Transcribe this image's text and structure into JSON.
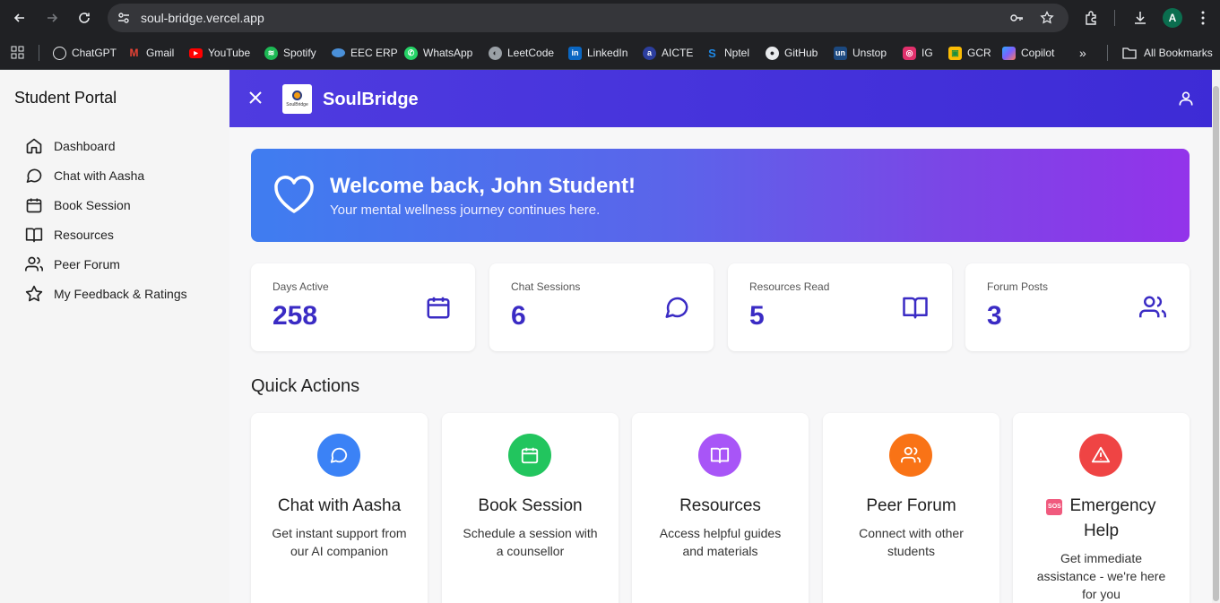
{
  "browser": {
    "url": "soul-bridge.vercel.app",
    "profile_initial": "A",
    "bookmarks": [
      {
        "label": "ChatGPT",
        "icon": "chatgpt-icon",
        "color": "#e8eaed"
      },
      {
        "label": "Gmail",
        "icon": "gmail-icon",
        "color": "#ea4335"
      },
      {
        "label": "YouTube",
        "icon": "youtube-icon",
        "color": "#ff0000"
      },
      {
        "label": "Spotify",
        "icon": "spotify-icon",
        "color": "#1db954"
      },
      {
        "label": "EEC ERP",
        "icon": "eec-erp-icon",
        "color": "#4a90d9"
      },
      {
        "label": "WhatsApp",
        "icon": "whatsapp-icon",
        "color": "#25d366"
      },
      {
        "label": "LeetCode",
        "icon": "leetcode-icon",
        "color": "#9aa0a6"
      },
      {
        "label": "LinkedIn",
        "icon": "linkedin-icon",
        "color": "#0a66c2"
      },
      {
        "label": "AICTE",
        "icon": "aicte-icon",
        "color": "#2c3e9e"
      },
      {
        "label": "Nptel",
        "icon": "nptel-icon",
        "color": "#1e88e5"
      },
      {
        "label": "GitHub",
        "icon": "github-icon",
        "color": "#e8eaed"
      },
      {
        "label": "Unstop",
        "icon": "unstop-icon",
        "color": "#1c4980"
      },
      {
        "label": "IG",
        "icon": "instagram-icon",
        "color": "#e1306c"
      },
      {
        "label": "GCR",
        "icon": "google-classroom-icon",
        "color": "#fbbc04"
      },
      {
        "label": "Copilot",
        "icon": "copilot-icon",
        "color": "#7b61ff"
      }
    ],
    "all_bookmarks": "All Bookmarks"
  },
  "sidebar": {
    "title": "Student Portal",
    "items": [
      {
        "label": "Dashboard",
        "icon": "home-icon"
      },
      {
        "label": "Chat with Aasha",
        "icon": "chat-icon"
      },
      {
        "label": "Book Session",
        "icon": "calendar-icon"
      },
      {
        "label": "Resources",
        "icon": "book-icon"
      },
      {
        "label": "Peer Forum",
        "icon": "users-icon"
      },
      {
        "label": "My Feedback & Ratings",
        "icon": "star-icon"
      }
    ]
  },
  "header": {
    "brand": "SoulBridge",
    "logo_text": "SoulBridge",
    "accent": "#4433dd"
  },
  "banner": {
    "title": "Welcome back, John Student!",
    "subtitle": "Your mental wellness journey continues here."
  },
  "stats": [
    {
      "label": "Days Active",
      "value": "258",
      "icon": "calendar-icon"
    },
    {
      "label": "Chat Sessions",
      "value": "6",
      "icon": "chat-icon"
    },
    {
      "label": "Resources Read",
      "value": "5",
      "icon": "book-icon"
    },
    {
      "label": "Forum Posts",
      "value": "3",
      "icon": "users-icon"
    }
  ],
  "quick_actions": {
    "title": "Quick Actions",
    "cards": [
      {
        "title": "Chat with Aasha",
        "desc": "Get instant support from our AI companion",
        "color": "#3b82f6",
        "icon": "chat-icon"
      },
      {
        "title": "Book Session",
        "desc": "Schedule a session with a counsellor",
        "color": "#22c55e",
        "icon": "calendar-icon"
      },
      {
        "title": "Resources",
        "desc": "Access helpful guides and materials",
        "color": "#a855f7",
        "icon": "book-icon"
      },
      {
        "title": "Peer Forum",
        "desc": "Connect with other students",
        "color": "#f97316",
        "icon": "users-icon"
      },
      {
        "title": "Emergency Help",
        "badge": "SOS",
        "desc": "Get immediate assistance - we're here for you",
        "color": "#ef4444",
        "icon": "alert-icon"
      }
    ]
  }
}
